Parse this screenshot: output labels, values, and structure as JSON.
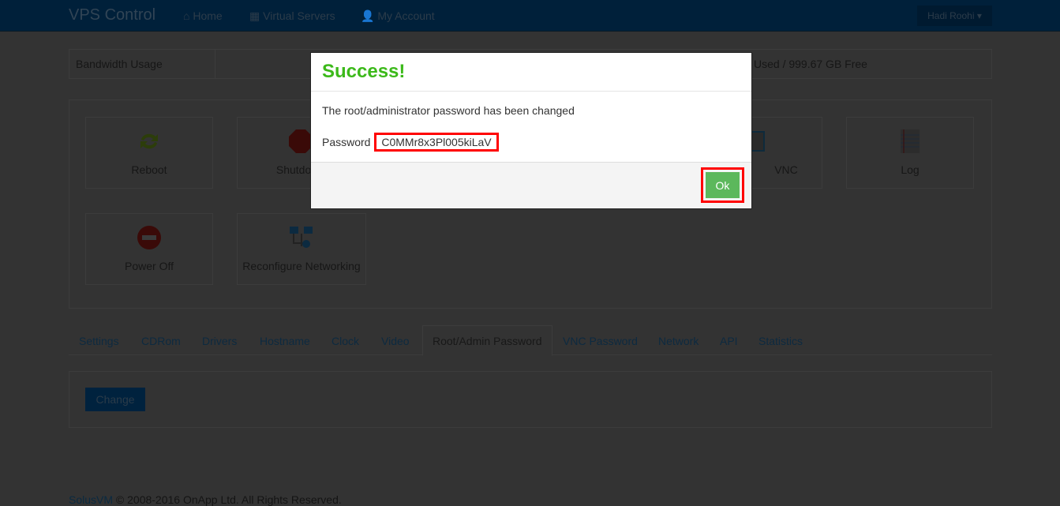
{
  "navbar": {
    "brand": "VPS Control",
    "links": [
      {
        "label": "Home",
        "icon": "home-icon"
      },
      {
        "label": "Virtual Servers",
        "icon": "grid-icon"
      },
      {
        "label": "My Account",
        "icon": "user-icon"
      }
    ],
    "user": "Hadi Roohi"
  },
  "bandwidth": {
    "label": "Bandwidth Usage",
    "value": "Used / 999.67 GB Free"
  },
  "actions": [
    {
      "label": "Reboot"
    },
    {
      "label": "Shutdown"
    },
    {
      "label": "VNC"
    },
    {
      "label": "Log"
    },
    {
      "label": "Power Off"
    },
    {
      "label": "Reconfigure Networking"
    }
  ],
  "tabs": [
    "Settings",
    "CDRom",
    "Drivers",
    "Hostname",
    "Clock",
    "Video",
    "Root/Admin Password",
    "VNC Password",
    "Network",
    "API",
    "Statistics"
  ],
  "active_tab": "Root/Admin Password",
  "change_button": "Change",
  "footer": {
    "link": "SolusVM",
    "text": "© 2008-2016 OnApp Ltd. All Rights Reserved."
  },
  "modal": {
    "title": "Success!",
    "message": "The root/administrator password has been changed",
    "password_label": "Password",
    "password": "C0MMr8x3Pl005kiLaV",
    "ok": "Ok"
  },
  "colors": {
    "success": "#3cb91a",
    "ok_button": "#5cb85c",
    "highlight": "#ff0000"
  }
}
